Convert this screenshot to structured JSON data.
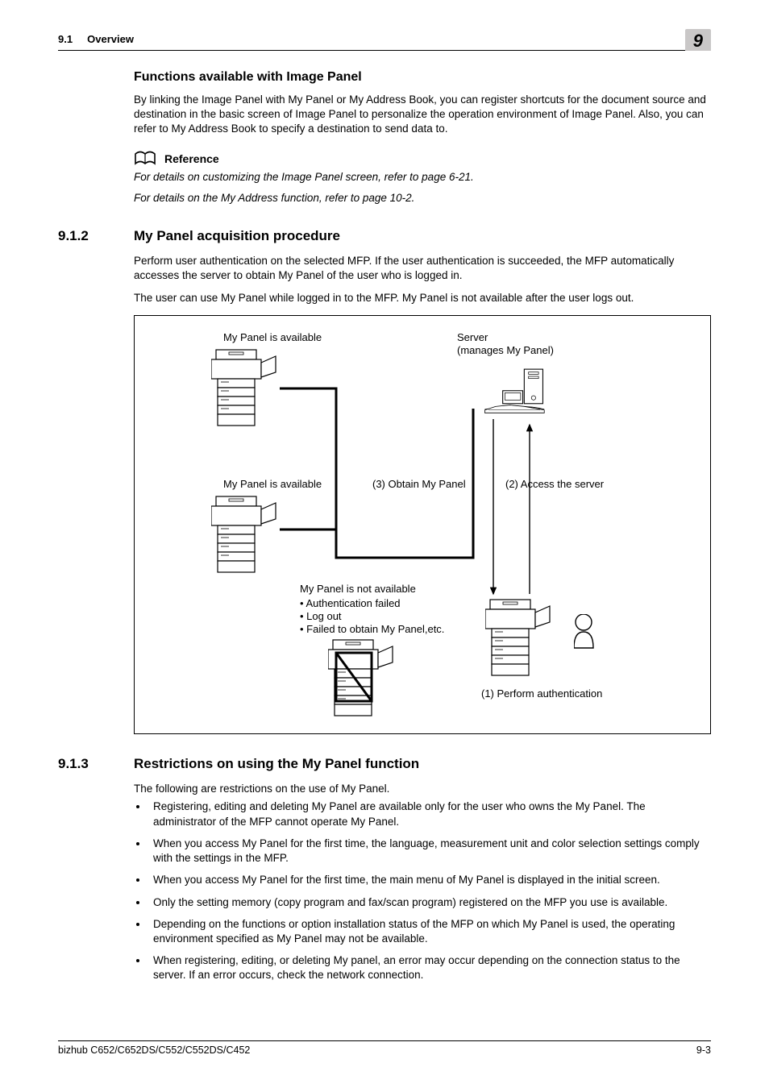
{
  "header": {
    "section_num": "9.1",
    "section_title": "Overview",
    "chapter": "9"
  },
  "s1": {
    "heading": "Functions available with Image Panel",
    "p1": "By linking the Image Panel with My Panel or My Address Book, you can register shortcuts for the document source and destination in the basic screen of Image Panel to personalize the operation environment of Image Panel. Also, you can refer to My Address Book to specify a destination to send data to.",
    "ref_label": "Reference",
    "ref_line1": "For details on customizing the Image Panel screen, refer to page 6-21.",
    "ref_line2": "For details on the My Address function, refer to page 10-2."
  },
  "s2": {
    "num": "9.1.2",
    "heading": "My Panel acquisition procedure",
    "p1": "Perform user authentication on the selected MFP. If the user authentication is succeeded, the MFP automatically accesses the server to obtain My Panel of the user who is logged in.",
    "p2": "The user can use My Panel while logged in to the MFP. My Panel is not available after the user logs out.",
    "diagram": {
      "label_top_left": "My Panel is available",
      "label_server1": "Server",
      "label_server2": "(manages My Panel)",
      "label_mid_left": "My Panel is available",
      "label_obtain": "(3) Obtain My Panel",
      "label_access": "(2) Access the server",
      "not_avail_title": "My Panel is not available",
      "not_avail_b1": "• Authentication failed",
      "not_avail_b2": "• Log out",
      "not_avail_b3": "• Failed to obtain My Panel,etc.",
      "label_auth": "(1) Perform authentication"
    }
  },
  "s3": {
    "num": "9.1.3",
    "heading": "Restrictions on using the My Panel function",
    "intro": "The following are restrictions on the use of My Panel.",
    "items": [
      "Registering, editing and deleting My Panel are available only for the user who owns the My Panel. The administrator of the MFP cannot operate My Panel.",
      "When you access My Panel for the first time, the language, measurement unit and color selection settings comply with the settings in the MFP.",
      "When you access My Panel for the first time, the main menu of My Panel is displayed in the initial screen.",
      "Only the setting memory (copy program and fax/scan program) registered on the MFP you use is available.",
      "Depending on the functions or option installation status of the MFP on which My Panel is used, the operating environment specified as My Panel may not be available.",
      "When registering, editing, or deleting My panel, an error may occur depending on the connection status to the server. If an error occurs, check the network connection."
    ]
  },
  "footer": {
    "left": "bizhub C652/C652DS/C552/C552DS/C452",
    "right": "9-3"
  }
}
